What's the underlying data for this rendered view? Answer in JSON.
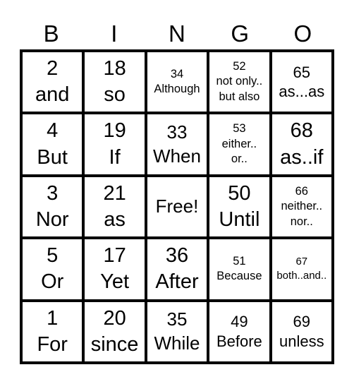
{
  "header": {
    "letters": [
      "B",
      "I",
      "N",
      "G",
      "O"
    ]
  },
  "cells": [
    [
      {
        "lines": [
          "2",
          "and"
        ],
        "size": "xl"
      },
      {
        "lines": [
          "18",
          "so"
        ],
        "size": "xl"
      },
      {
        "lines": [
          "34",
          "Although"
        ],
        "size": "sm"
      },
      {
        "lines": [
          "52",
          "not only..",
          "but also"
        ],
        "size": "sm"
      },
      {
        "lines": [
          "65",
          "as...as"
        ],
        "size": "md"
      }
    ],
    [
      {
        "lines": [
          "4",
          "But"
        ],
        "size": "xl"
      },
      {
        "lines": [
          "19",
          "If"
        ],
        "size": "xl"
      },
      {
        "lines": [
          "33",
          "When"
        ],
        "size": "lg"
      },
      {
        "lines": [
          "53",
          "either..",
          "or.."
        ],
        "size": "sm"
      },
      {
        "lines": [
          "68",
          "as..if"
        ],
        "size": "xl"
      }
    ],
    [
      {
        "lines": [
          "3",
          "Nor"
        ],
        "size": "xl"
      },
      {
        "lines": [
          "21",
          "as"
        ],
        "size": "xl"
      },
      {
        "lines": [
          "Free!"
        ],
        "size": "lg"
      },
      {
        "lines": [
          "50",
          "Until"
        ],
        "size": "xl"
      },
      {
        "lines": [
          "66",
          "neither..",
          "nor.."
        ],
        "size": "sm"
      }
    ],
    [
      {
        "lines": [
          "5",
          "Or"
        ],
        "size": "xl"
      },
      {
        "lines": [
          "17",
          "Yet"
        ],
        "size": "xl"
      },
      {
        "lines": [
          "36",
          "After"
        ],
        "size": "xl"
      },
      {
        "lines": [
          "51",
          "Because"
        ],
        "size": "sm"
      },
      {
        "lines": [
          "67",
          "both..and.."
        ],
        "size": "xs"
      }
    ],
    [
      {
        "lines": [
          "1",
          "For"
        ],
        "size": "xl"
      },
      {
        "lines": [
          "20",
          "since"
        ],
        "size": "xl"
      },
      {
        "lines": [
          "35",
          "While"
        ],
        "size": "lg"
      },
      {
        "lines": [
          "49",
          "Before"
        ],
        "size": "md"
      },
      {
        "lines": [
          "69",
          "unless"
        ],
        "size": "md"
      }
    ]
  ]
}
